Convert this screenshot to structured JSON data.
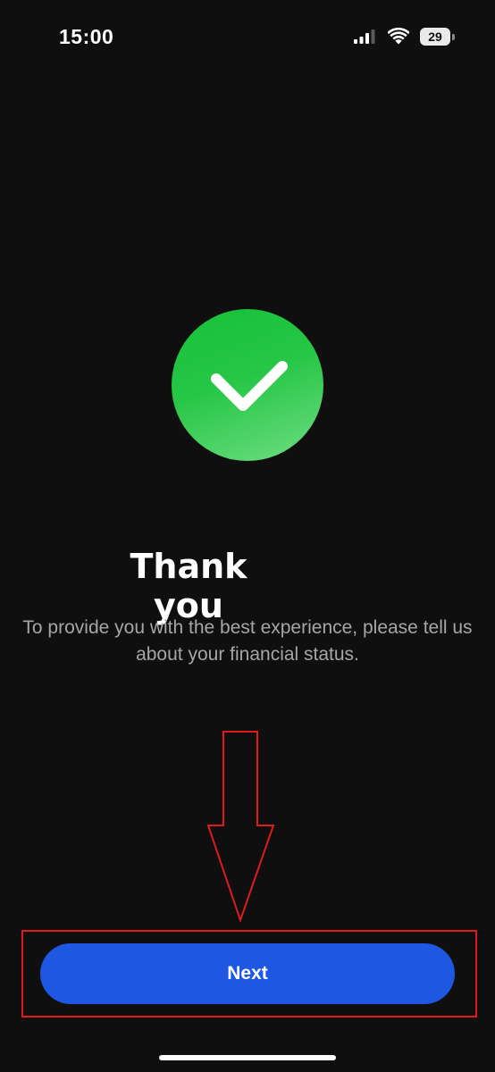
{
  "status_bar": {
    "time": "15:00",
    "battery_level": "29",
    "icons": [
      "signal-icon",
      "wifi-icon",
      "battery-icon"
    ]
  },
  "content": {
    "icon": "checkmark-icon",
    "title": "Thank you",
    "subtitle": "To provide you with the best experience, please tell us about your financial status."
  },
  "annotation": {
    "arrow": "down-arrow-icon",
    "color": "#e01b1b"
  },
  "footer": {
    "next_label": "Next"
  },
  "colors": {
    "background": "#0f0f10",
    "success_green": "#26c646",
    "primary_button": "#1e58e2",
    "subtitle_text": "#a6a6a6"
  }
}
